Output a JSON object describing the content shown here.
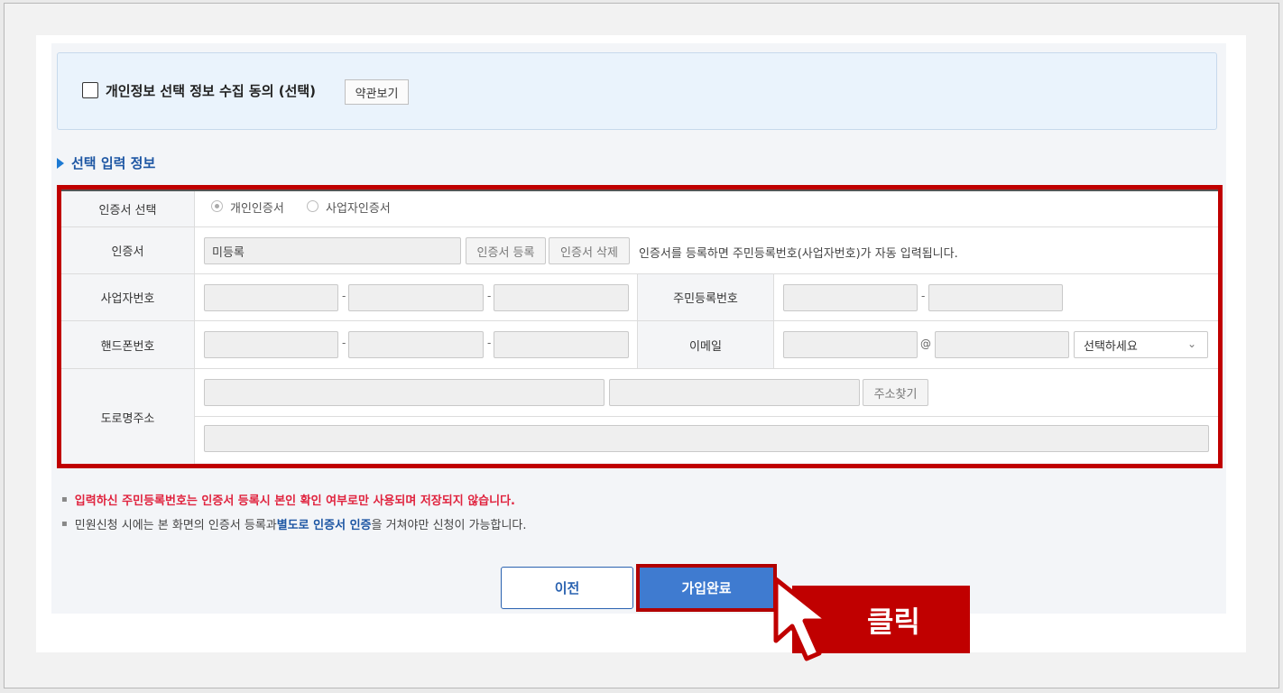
{
  "consent": {
    "checkbox_label": "개인정보 선택 정보 수집 동의 (선택)",
    "terms_button": "약관보기",
    "checked": false
  },
  "section_title": "선택 입력 정보",
  "form": {
    "cert_select": {
      "label": "인증서 선택",
      "options": [
        "개인인증서",
        "사업자인증서"
      ],
      "selected": "개인인증서"
    },
    "certificate": {
      "label": "인증서",
      "value": "미등록",
      "register_button": "인증서 등록",
      "delete_button": "인증서 삭제",
      "hint": "인증서를 등록하면 주민등록번호(사업자번호)가 자동 입력됩니다."
    },
    "business_number": {
      "label": "사업자번호",
      "separator": "-"
    },
    "resident_number": {
      "label": "주민등록번호",
      "separator": "-"
    },
    "phone": {
      "label": "핸드폰번호",
      "separator": "-"
    },
    "email": {
      "label": "이메일",
      "at": "@",
      "domain_select": "선택하세요"
    },
    "address": {
      "label": "도로명주소",
      "search_button": "주소찾기"
    }
  },
  "notes": {
    "line1": "입력하신 주민등록번호는 인증서 등록시 본인 확인 여부로만 사용되며 저장되지 않습니다.",
    "line2_before": "민원신청 시에는 본 화면의 인증서 등록과 ",
    "line2_highlight": "별도로 인증서 인증",
    "line2_after": "을 거쳐야만 신청이 가능합니다."
  },
  "buttons": {
    "prev": "이전",
    "complete": "가입완료"
  },
  "callout": {
    "text": "클릭"
  },
  "colors": {
    "highlight_red": "#c00000",
    "primary_blue": "#3f7bd0",
    "note_red": "#e0233e"
  }
}
